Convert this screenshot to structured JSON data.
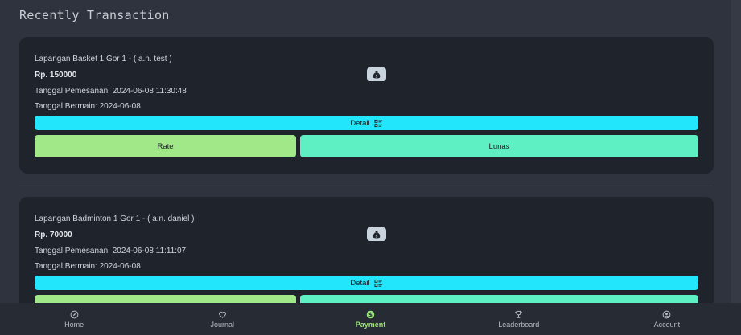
{
  "page": {
    "title": "Recently Transaction"
  },
  "transactions": [
    {
      "venue": "Lapangan Basket 1 Gor 1 - ( a.n. test )",
      "price": "Rp. 150000",
      "booking_date": "Tanggal Pemesanan: 2024-06-08 11:30:48",
      "play_date": "Tanggal Bermain: 2024-06-08",
      "detail_label": "Detail",
      "rate_label": "Rate",
      "status_label": "Lunas"
    },
    {
      "venue": "Lapangan Badminton 1 Gor 1 - ( a.n. daniel )",
      "price": "Rp. 70000",
      "booking_date": "Tanggal Pemesanan: 2024-06-08 11:11:07",
      "play_date": "Tanggal Bermain: 2024-06-08",
      "detail_label": "Detail"
    }
  ],
  "nav": {
    "items": [
      {
        "label": "Home",
        "icon": "compass-icon"
      },
      {
        "label": "Journal",
        "icon": "journal-icon"
      },
      {
        "label": "Payment",
        "icon": "dollar-icon",
        "active": true
      },
      {
        "label": "Leaderboard",
        "icon": "trophy-icon"
      },
      {
        "label": "Account",
        "icon": "account-icon"
      }
    ]
  },
  "colors": {
    "background": "#2e333d",
    "card": "#1f232b",
    "detail_button": "#22e6fb",
    "rate_button": "#a1e889",
    "status_button": "#5eefc2",
    "nav_active": "#9ae67a"
  }
}
